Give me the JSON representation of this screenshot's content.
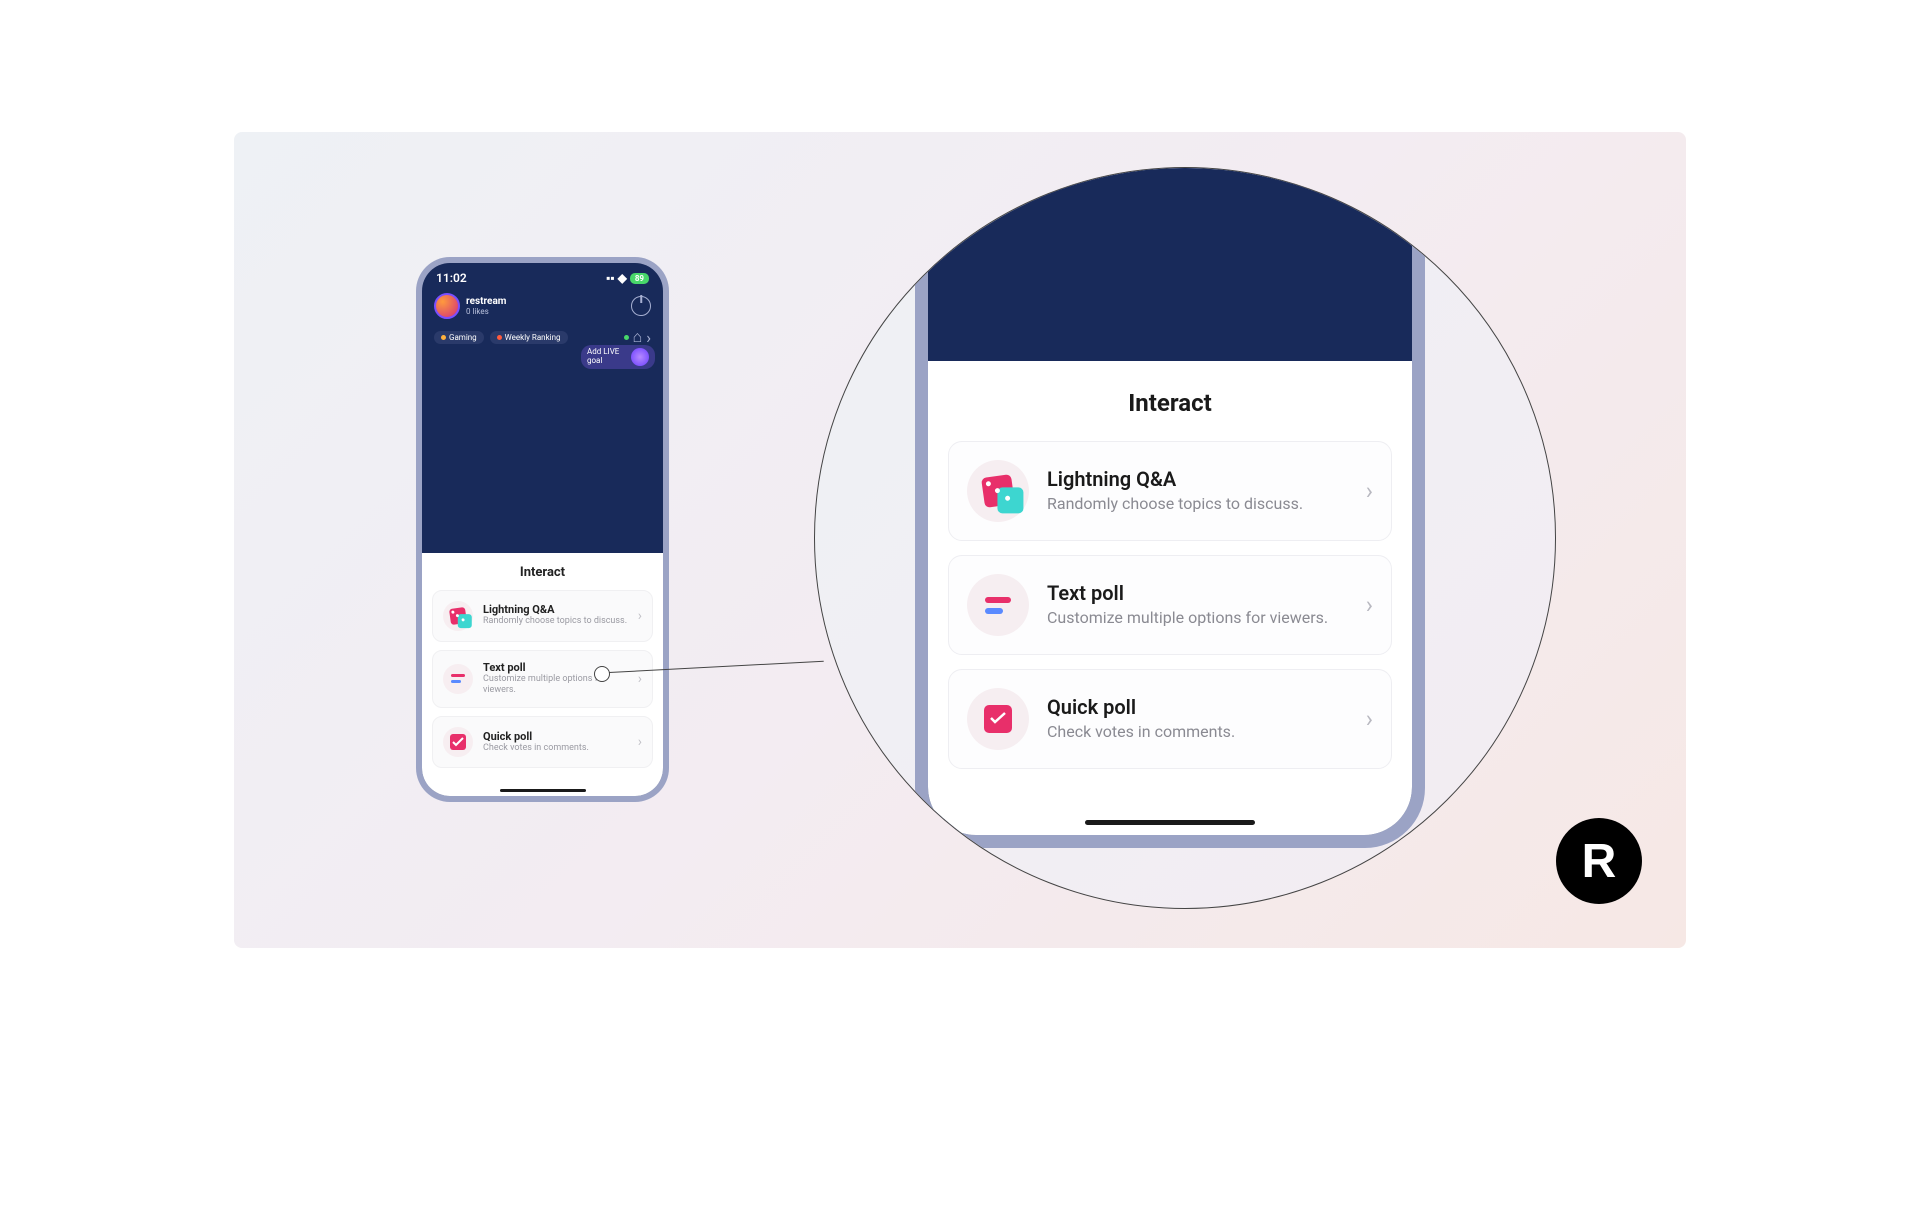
{
  "statusbar": {
    "time": "11:02",
    "battery": "89"
  },
  "profile": {
    "username": "restream",
    "likes": "0 likes"
  },
  "tags": {
    "gaming": "Gaming",
    "ranking": "Weekly Ranking"
  },
  "live_goal": "Add LIVE goal",
  "sheet": {
    "title": "Interact",
    "items": [
      {
        "title": "Lightning Q&A",
        "desc": "Randomly choose topics to discuss."
      },
      {
        "title": "Text poll",
        "desc": "Customize multiple options for viewers."
      },
      {
        "title": "Quick poll",
        "desc": "Check votes in comments."
      }
    ]
  },
  "logo": "R"
}
